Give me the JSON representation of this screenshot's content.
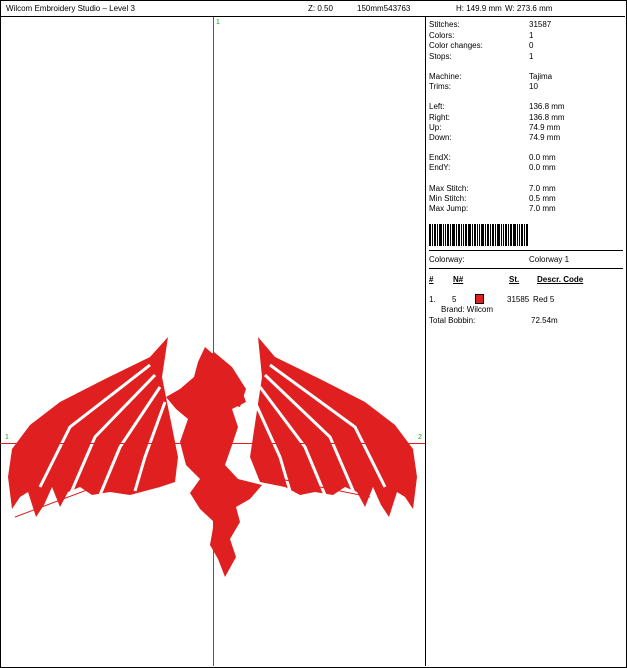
{
  "header": {
    "title": "Wilcom Embroidery Studio – Level 3",
    "zoom": "Z: 0.50",
    "design_code": "150mm543763",
    "height": "H: 149.9 mm",
    "width": "W: 273.6 mm"
  },
  "canvas": {
    "marker_top": "1",
    "marker_left": "1",
    "marker_right": "2",
    "design_color": "#e02020",
    "axis_color": "#e02020"
  },
  "stats": {
    "stitches_label": "Stitches:",
    "stitches": "31587",
    "colors_label": "Colors:",
    "colors": "1",
    "color_changes_label": "Color changes:",
    "color_changes": "0",
    "stops_label": "Stops:",
    "stops": "1",
    "machine_label": "Machine:",
    "machine": "Tajima",
    "trims_label": "Trims:",
    "trims": "10",
    "left_label": "Left:",
    "left": "136.8 mm",
    "right_label": "Right:",
    "right": "136.8 mm",
    "up_label": "Up:",
    "up": "74.9 mm",
    "down_label": "Down:",
    "down": "74.9 mm",
    "endx_label": "EndX:",
    "endx": "0.0 mm",
    "endy_label": "EndY:",
    "endy": "0.0 mm",
    "max_stitch_label": "Max Stitch:",
    "max_stitch": "7.0 mm",
    "min_stitch_label": "Min Stitch:",
    "min_stitch": "0.5 mm",
    "max_jump_label": "Max Jump:",
    "max_jump": "7.0 mm"
  },
  "colorway": {
    "label": "Colorway:",
    "value": "Colorway 1",
    "columns": {
      "index": "#",
      "needle": "N#",
      "stitches": "St.",
      "descr": "Descr. Code"
    },
    "rows": [
      {
        "index": "1.",
        "needle": "5",
        "color": "#e02020",
        "stitches": "31585",
        "descr": "Red 5",
        "brand": "Brand: Wilcom"
      }
    ],
    "total_bobbin_label": "Total Bobbin:",
    "total_bobbin": "72.54m"
  }
}
